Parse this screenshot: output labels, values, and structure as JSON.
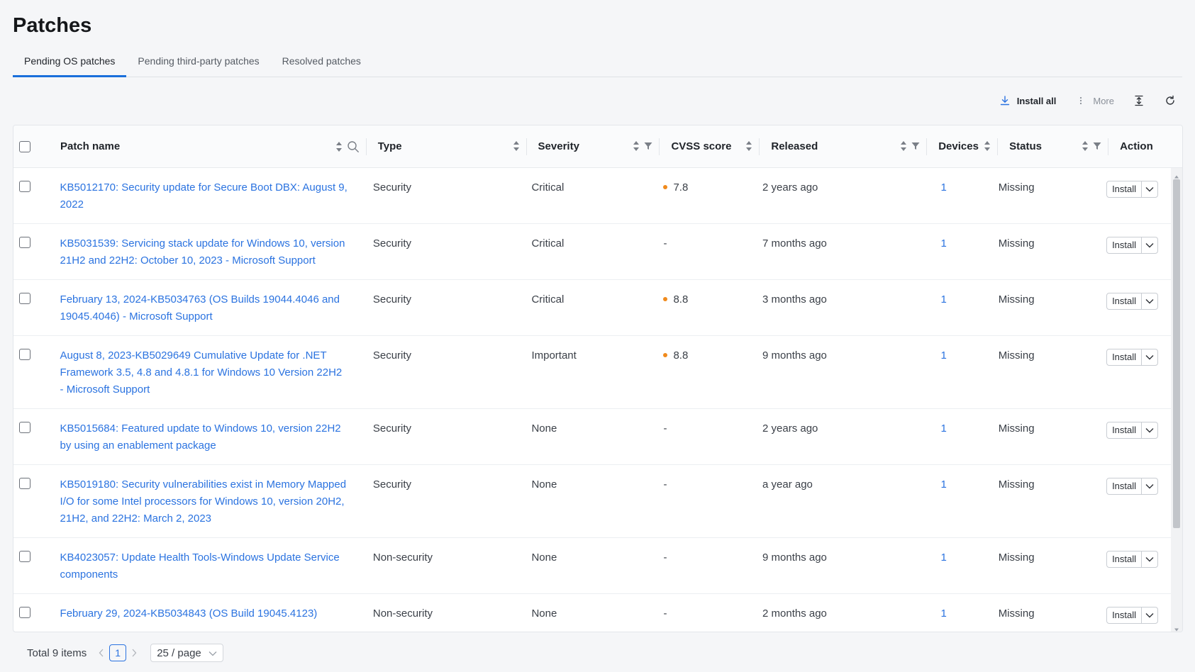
{
  "page": {
    "title": "Patches"
  },
  "tabs": [
    {
      "label": "Pending OS patches",
      "active": true
    },
    {
      "label": "Pending third-party patches",
      "active": false
    },
    {
      "label": "Resolved patches",
      "active": false
    }
  ],
  "toolbar": {
    "install_all_label": "Install all",
    "more_label": "More",
    "icons": [
      "download-icon",
      "more-vertical-icon",
      "column-height-icon",
      "refresh-icon"
    ]
  },
  "columns": {
    "patch_name": "Patch name",
    "type": "Type",
    "severity": "Severity",
    "cvss": "CVSS score",
    "released": "Released",
    "devices": "Devices",
    "status": "Status",
    "action": "Action"
  },
  "rows": [
    {
      "name": "KB5012170: Security update for Secure Boot DBX: August 9, 2022",
      "type": "Security",
      "severity": "Critical",
      "cvss": "7.8",
      "has_cvss": true,
      "released": "2 years ago",
      "devices": "1",
      "status": "Missing",
      "action": "Install"
    },
    {
      "name": "KB5031539: Servicing stack update for Windows 10, version 21H2 and 22H2: October 10, 2023 - Microsoft Support",
      "type": "Security",
      "severity": "Critical",
      "cvss": "-",
      "has_cvss": false,
      "released": "7 months ago",
      "devices": "1",
      "status": "Missing",
      "action": "Install"
    },
    {
      "name": "February 13, 2024-KB5034763 (OS Builds 19044.4046 and 19045.4046) - Microsoft Support",
      "type": "Security",
      "severity": "Critical",
      "cvss": "8.8",
      "has_cvss": true,
      "released": "3 months ago",
      "devices": "1",
      "status": "Missing",
      "action": "Install"
    },
    {
      "name": "August 8, 2023-KB5029649 Cumulative Update for .NET Framework 3.5, 4.8 and 4.8.1 for Windows 10 Version 22H2 - Microsoft Support",
      "type": "Security",
      "severity": "Important",
      "cvss": "8.8",
      "has_cvss": true,
      "released": "9 months ago",
      "devices": "1",
      "status": "Missing",
      "action": "Install"
    },
    {
      "name": "KB5015684: Featured update to Windows 10, version 22H2 by using an enablement package",
      "type": "Security",
      "severity": "None",
      "cvss": "-",
      "has_cvss": false,
      "released": "2 years ago",
      "devices": "1",
      "status": "Missing",
      "action": "Install"
    },
    {
      "name": "KB5019180: Security vulnerabilities exist in Memory Mapped I/O for some Intel processors for Windows 10, version 20H2, 21H2, and 22H2: March 2, 2023",
      "type": "Security",
      "severity": "None",
      "cvss": "-",
      "has_cvss": false,
      "released": "a year ago",
      "devices": "1",
      "status": "Missing",
      "action": "Install"
    },
    {
      "name": "KB4023057: Update Health Tools-Windows Update Service components",
      "type": "Non-security",
      "severity": "None",
      "cvss": "-",
      "has_cvss": false,
      "released": "9 months ago",
      "devices": "1",
      "status": "Missing",
      "action": "Install"
    },
    {
      "name": "February 29, 2024-KB5034843 (OS Build 19045.4123)",
      "type": "Non-security",
      "severity": "None",
      "cvss": "-",
      "has_cvss": false,
      "released": "2 months ago",
      "devices": "1",
      "status": "Missing",
      "action": "Install"
    }
  ],
  "pagination": {
    "total_label": "Total 9 items",
    "current_page": "1",
    "page_size_label": "25 / page"
  },
  "colors": {
    "accent": "#1a6fdb",
    "link": "#2b73e0",
    "cvss_dot": "#f08a1c"
  }
}
